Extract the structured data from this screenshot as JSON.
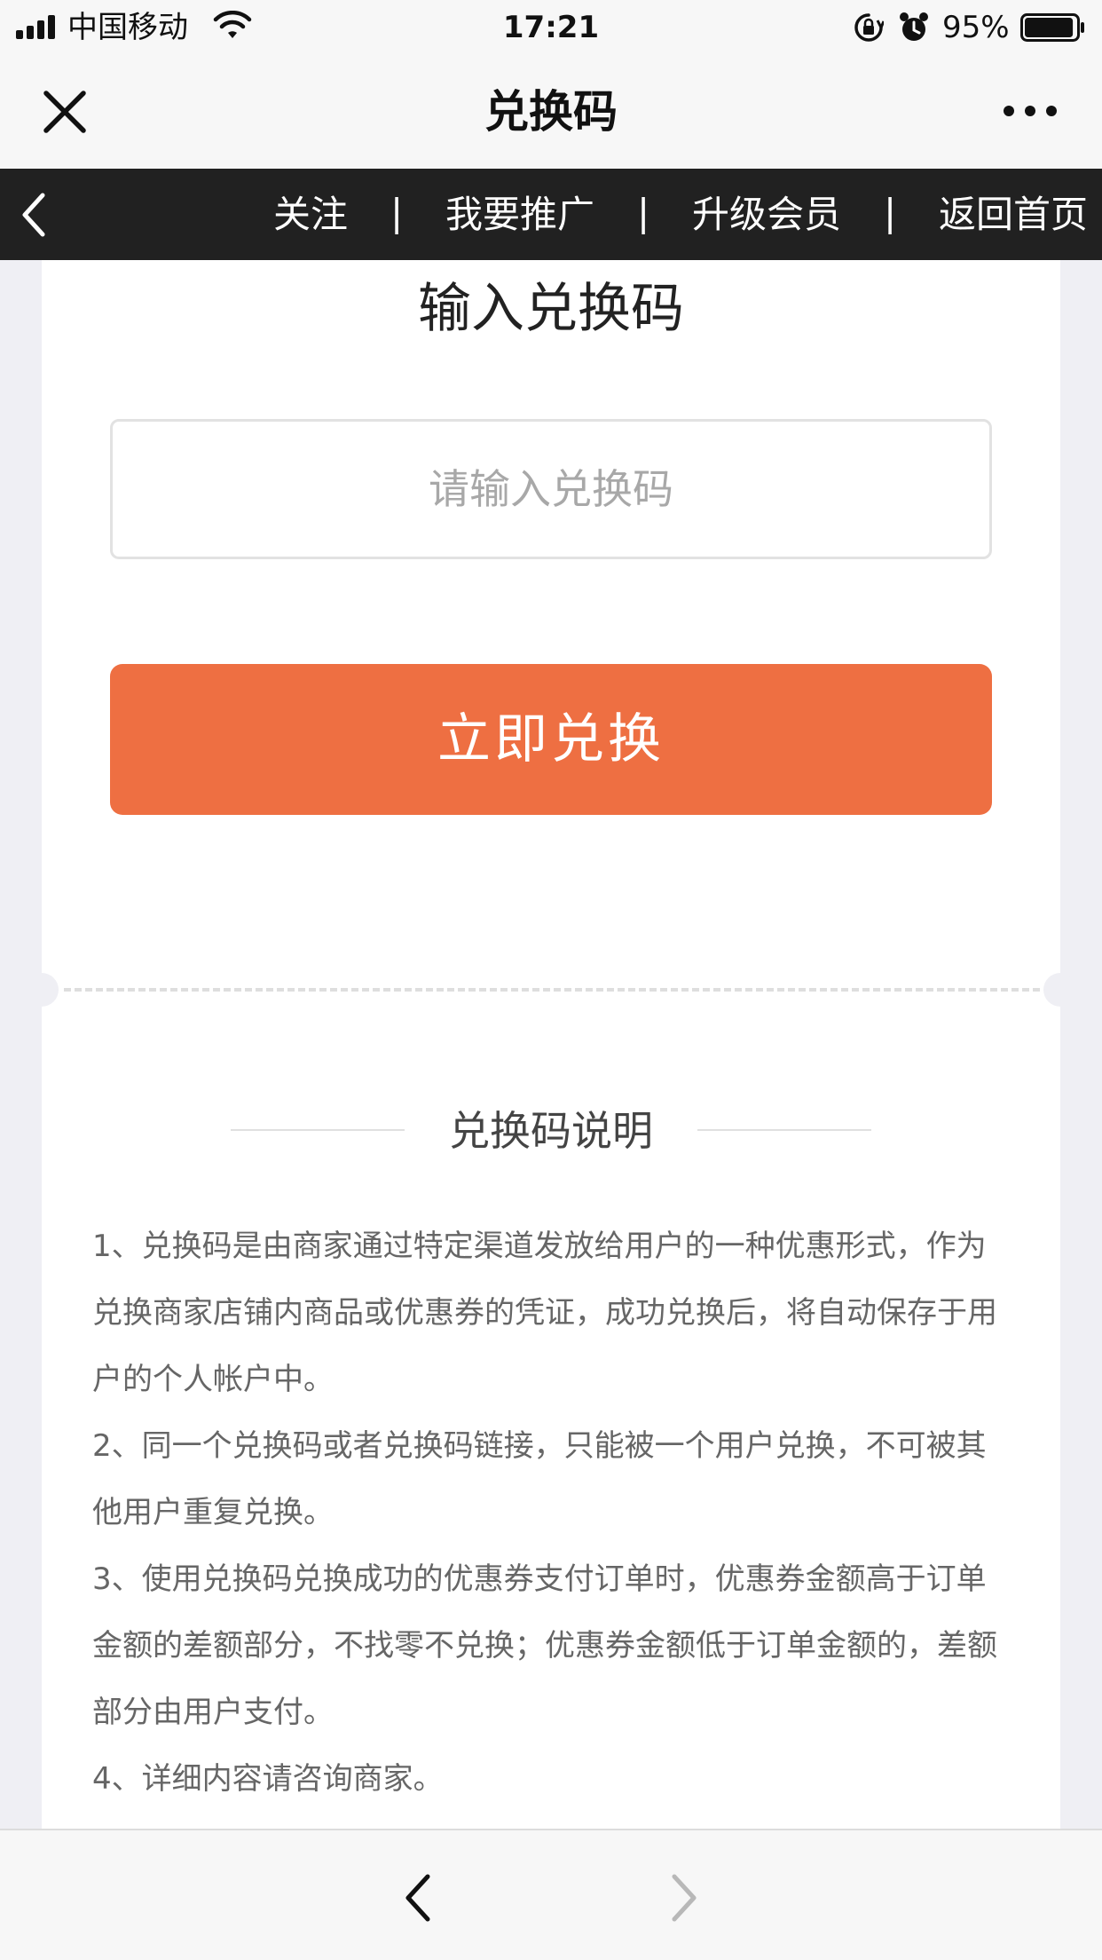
{
  "status_bar": {
    "carrier": "中国移动",
    "time": "17:21",
    "battery_percent": "95%",
    "battery_level": 0.95,
    "icons": [
      "signal-icon",
      "wifi-icon",
      "orientation-lock-icon",
      "alarm-icon",
      "battery-icon"
    ]
  },
  "title_bar": {
    "title": "兑换码",
    "icons": [
      "close-icon",
      "more-icon"
    ]
  },
  "nav_bar": {
    "items": [
      {
        "label": "关注"
      },
      {
        "label": "我要推广"
      },
      {
        "label": "升级会员"
      },
      {
        "label": "返回首页"
      }
    ],
    "separator": "|"
  },
  "redeem": {
    "heading": "输入兑换码",
    "input_value": "",
    "input_placeholder": "请输入兑换码",
    "button_label": "立即兑换"
  },
  "description": {
    "title": "兑换码说明",
    "items": [
      "1、兑换码是由商家通过特定渠道发放给用户的一种优惠形式，作为兑换商家店铺内商品或优惠券的凭证，成功兑换后，将自动保存于用户的个人帐户中。",
      "2、同一个兑换码或者兑换码链接，只能被一个用户兑换，不可被其他用户重复兑换。",
      "3、使用兑换码兑换成功的优惠券支付订单时，优惠券金额高于订单金额的差额部分，不找零不兑换；优惠券金额低于订单金额的，差额部分由用户支付。",
      "4、详细内容请咨询商家。"
    ]
  },
  "bottom_bar": {
    "back_enabled": true,
    "forward_enabled": false
  },
  "colors": {
    "accent": "#ee6f42",
    "nav_background": "#212121",
    "page_background": "#efeff4",
    "card_background": "#ffffff",
    "body_text": "#666666",
    "placeholder_text": "#a8a8a8"
  }
}
